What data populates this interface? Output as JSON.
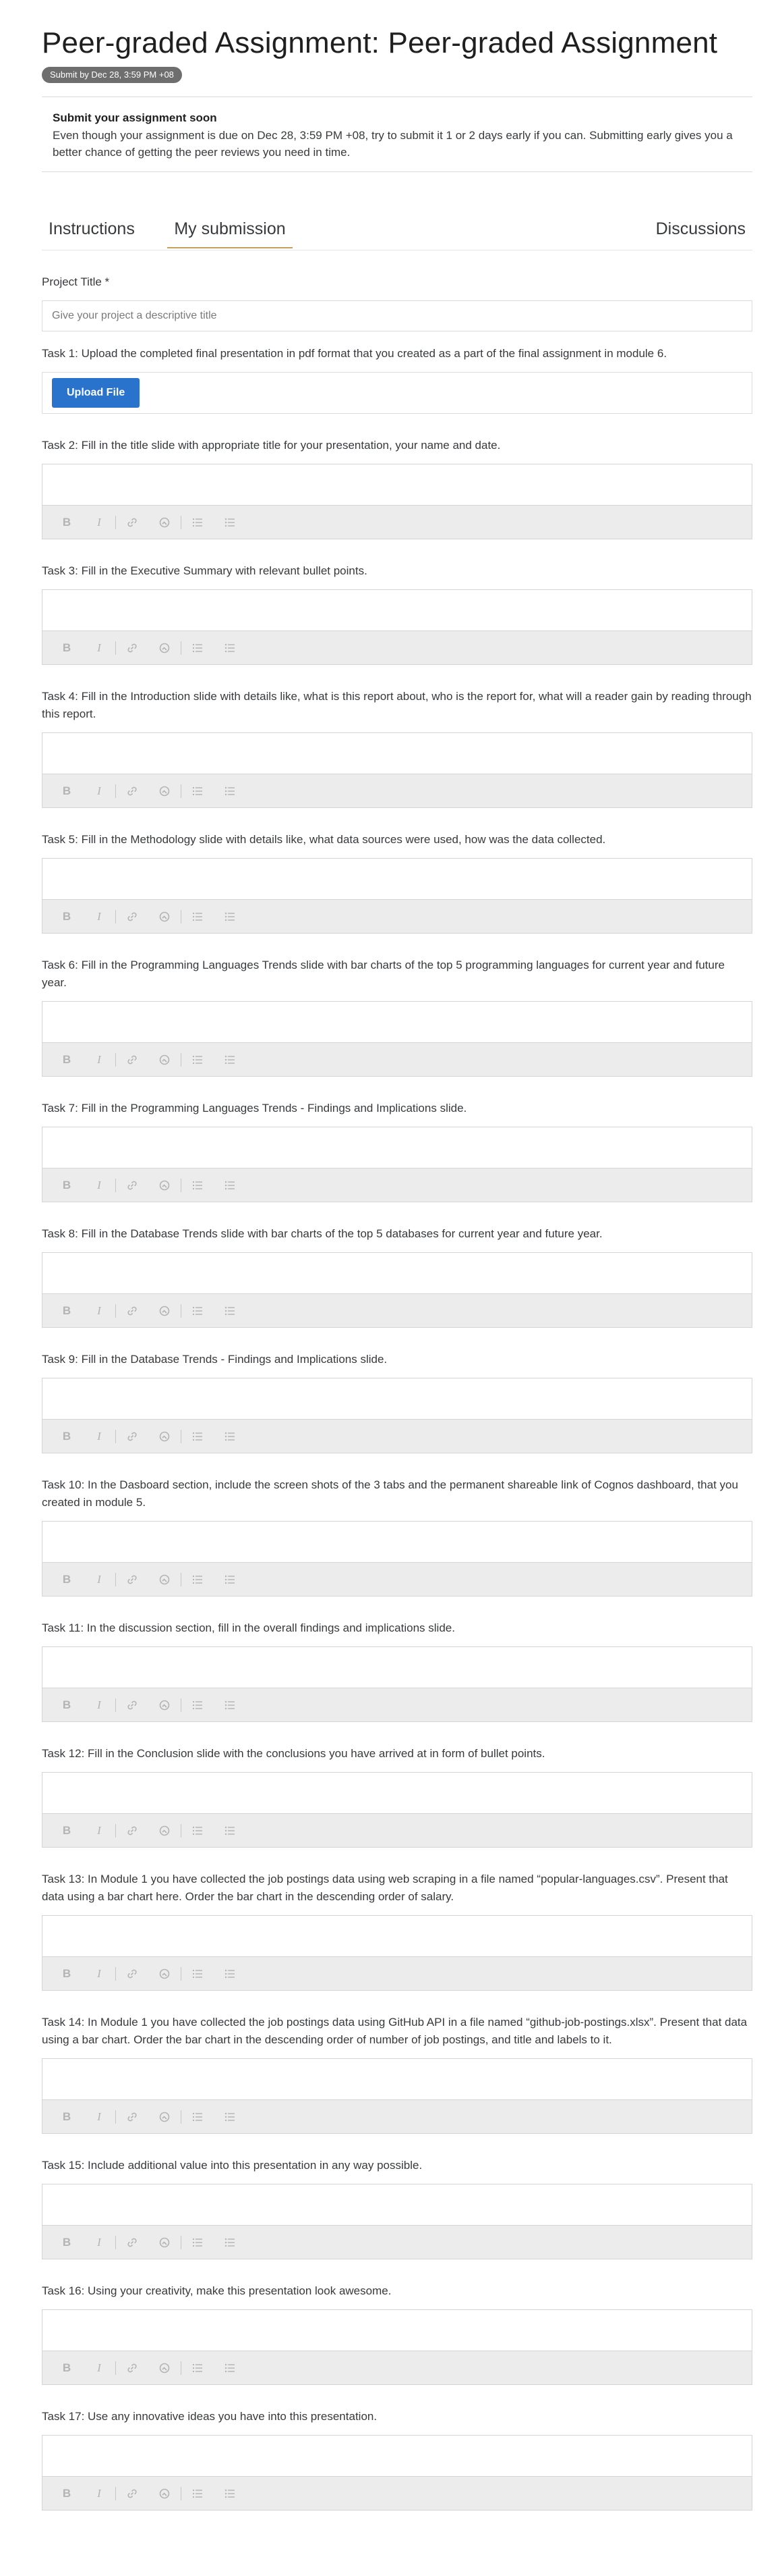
{
  "header": {
    "title": "Peer-graded Assignment: Peer-graded Assignment",
    "due_badge": "Submit by Dec 28, 3:59 PM +08"
  },
  "notice": {
    "title": "Submit your assignment soon",
    "body": "Even though your assignment is due on Dec 28, 3:59 PM +08, try to submit it 1 or 2 days early if you can. Submitting early gives you a better chance of getting the peer reviews you need in time."
  },
  "tabs": {
    "instructions": "Instructions",
    "my_submission": "My submission",
    "discussions": "Discussions"
  },
  "project": {
    "label": "Project Title *",
    "placeholder": "Give your project a descriptive title",
    "value": ""
  },
  "task1": {
    "label": "Task 1: Upload the completed final presentation in pdf format that you created as a part of the final assignment in module 6.",
    "button": "Upload File"
  },
  "toolbar": {
    "bold": "B",
    "italic": "I"
  },
  "tasks": [
    "Task 2: Fill in the title slide with appropriate title for your presentation, your name and date.",
    "Task 3: Fill in the Executive Summary with relevant bullet points.",
    "Task 4: Fill in the Introduction slide with details like, what is this report about, who is the report for, what will a reader gain by reading through this report.",
    "Task 5: Fill in the Methodology slide with details like, what data sources were used, how was the data collected.",
    "Task 6: Fill in the Programming Languages Trends slide with bar charts of the top 5 programming languages for current year and future year.",
    "Task 7: Fill in the Programming Languages Trends - Findings and Implications slide.",
    "Task 8: Fill in the Database Trends slide with bar charts of the top 5 databases for current year and future year.",
    "Task 9: Fill in the Database Trends - Findings and Implications slide.",
    "Task 10: In the Dasboard section, include the screen shots of the 3 tabs and the permanent shareable link of Cognos dashboard, that you created in module 5.",
    "Task 11: In the discussion section, fill in the overall findings and implications slide.",
    "Task 12: Fill in the Conclusion slide with the conclusions you have arrived at in form of bullet points.",
    "Task 13: In Module 1 you have collected the job postings data using web scraping in a file named “popular-languages.csv”. Present that data using a bar chart here. Order the bar chart in the descending order of salary.",
    "Task 14: In Module 1 you have collected the job postings data using GitHub API in a file named “github-job-postings.xlsx”. Present that data using a bar chart. Order the bar chart in the descending order of number of job postings, and title and labels to it.",
    "Task 15: Include additional value into this presentation in any way possible.",
    "Task 16: Using your creativity, make this presentation look awesome.",
    "Task 17: Use any innovative ideas you have into this presentation."
  ]
}
